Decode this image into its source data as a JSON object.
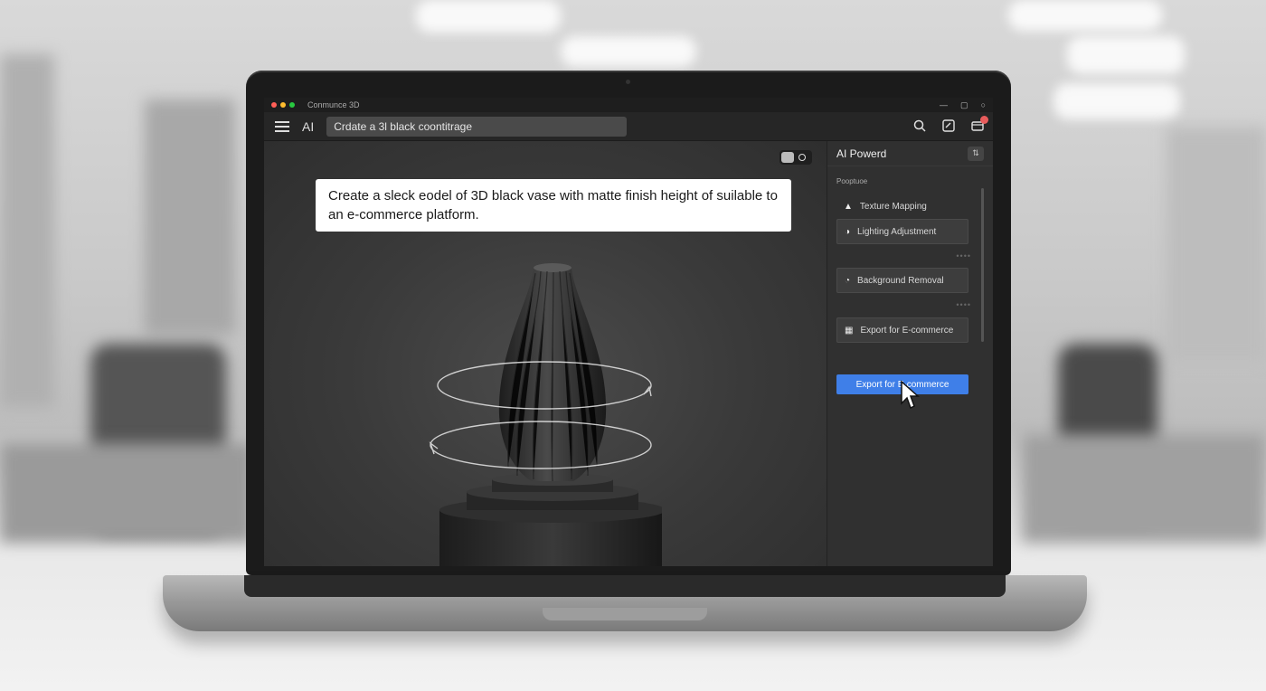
{
  "window": {
    "title": "Conmunce 3D",
    "traffic_lights": [
      "#ff5f57",
      "#febc2e",
      "#28c840"
    ]
  },
  "toolbar": {
    "menu_icon": "hamburger-icon",
    "ai_label": "AI",
    "search_value": "Crdate a 3l black coontitrage",
    "icons": [
      "search-icon",
      "edit-image-icon",
      "cart-icon"
    ]
  },
  "viewport": {
    "prompt": "Create a sleck eodel of 3D black vase with matte finish height of suilable to an e-commerce platform.",
    "toggle_state": "off"
  },
  "panel": {
    "title": "AI Powerd",
    "section_label": "Pooptuoe",
    "features": [
      {
        "label": "Texture Mapping",
        "icon": "texture-icon"
      },
      {
        "label": "Lighting Adjustment",
        "icon": "lighting-icon"
      },
      {
        "label": "Background Removal",
        "icon": "background-removal-icon"
      },
      {
        "label": "Export for E-commerce",
        "icon": "export-grid-icon"
      }
    ],
    "primary_action": "Export for E-commerce"
  },
  "colors": {
    "accent": "#3f7fe8",
    "notification": "#e85c5c"
  }
}
